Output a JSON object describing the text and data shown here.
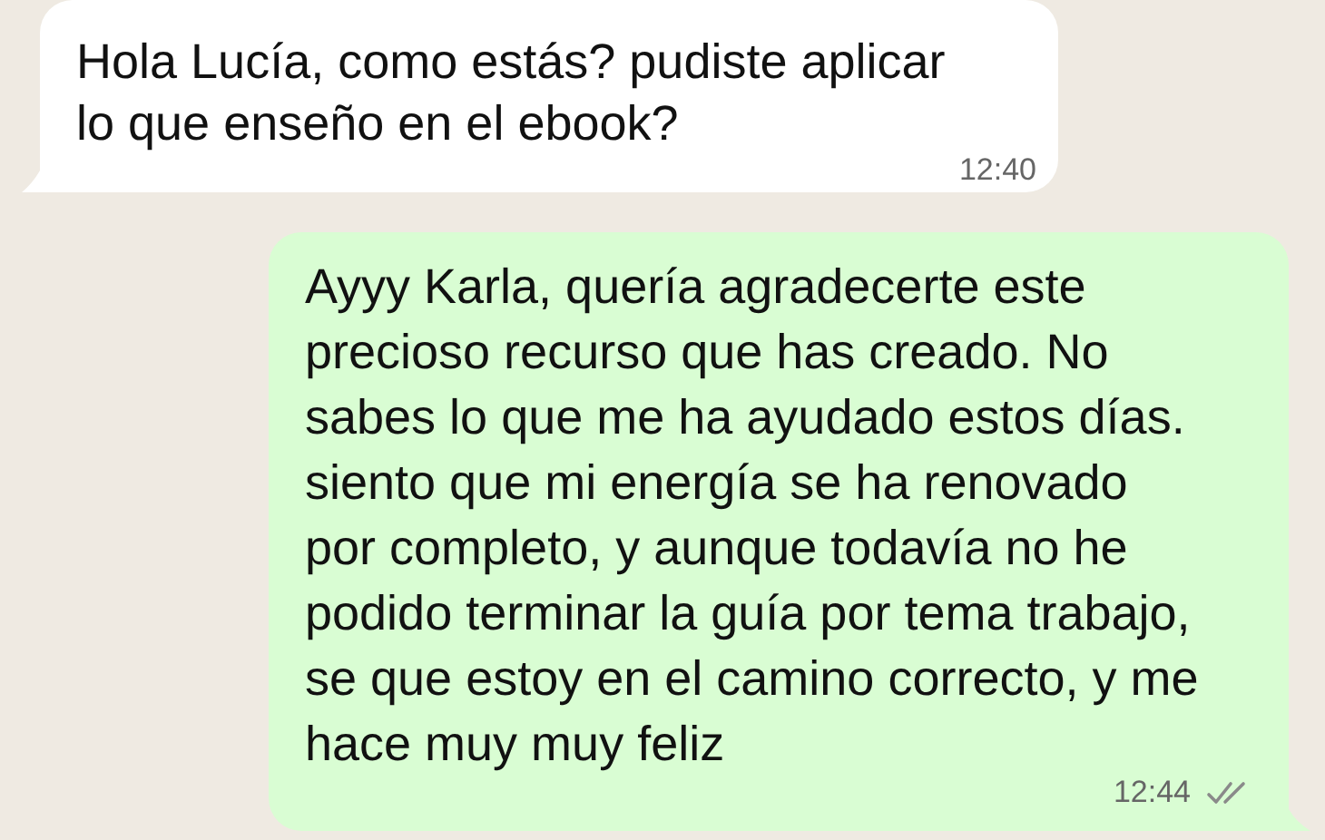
{
  "messages": [
    {
      "kind": "incoming",
      "text": "Hola Lucía, como estás? pudiste aplicar\nlo que enseño en el ebook?",
      "time": "12:40"
    },
    {
      "kind": "outgoing",
      "text": "Ayyy Karla, quería agradecerte este\nprecioso recurso que has creado. No\nsabes lo que me ha ayudado estos días.\nsiento que mi energía se ha renovado\npor completo, y aunque todavía no he\npodido terminar la guía por tema trabajo,\nse que estoy en el camino correcto, y me\nhace muy muy feliz",
      "time": "12:44",
      "read": false
    }
  ]
}
